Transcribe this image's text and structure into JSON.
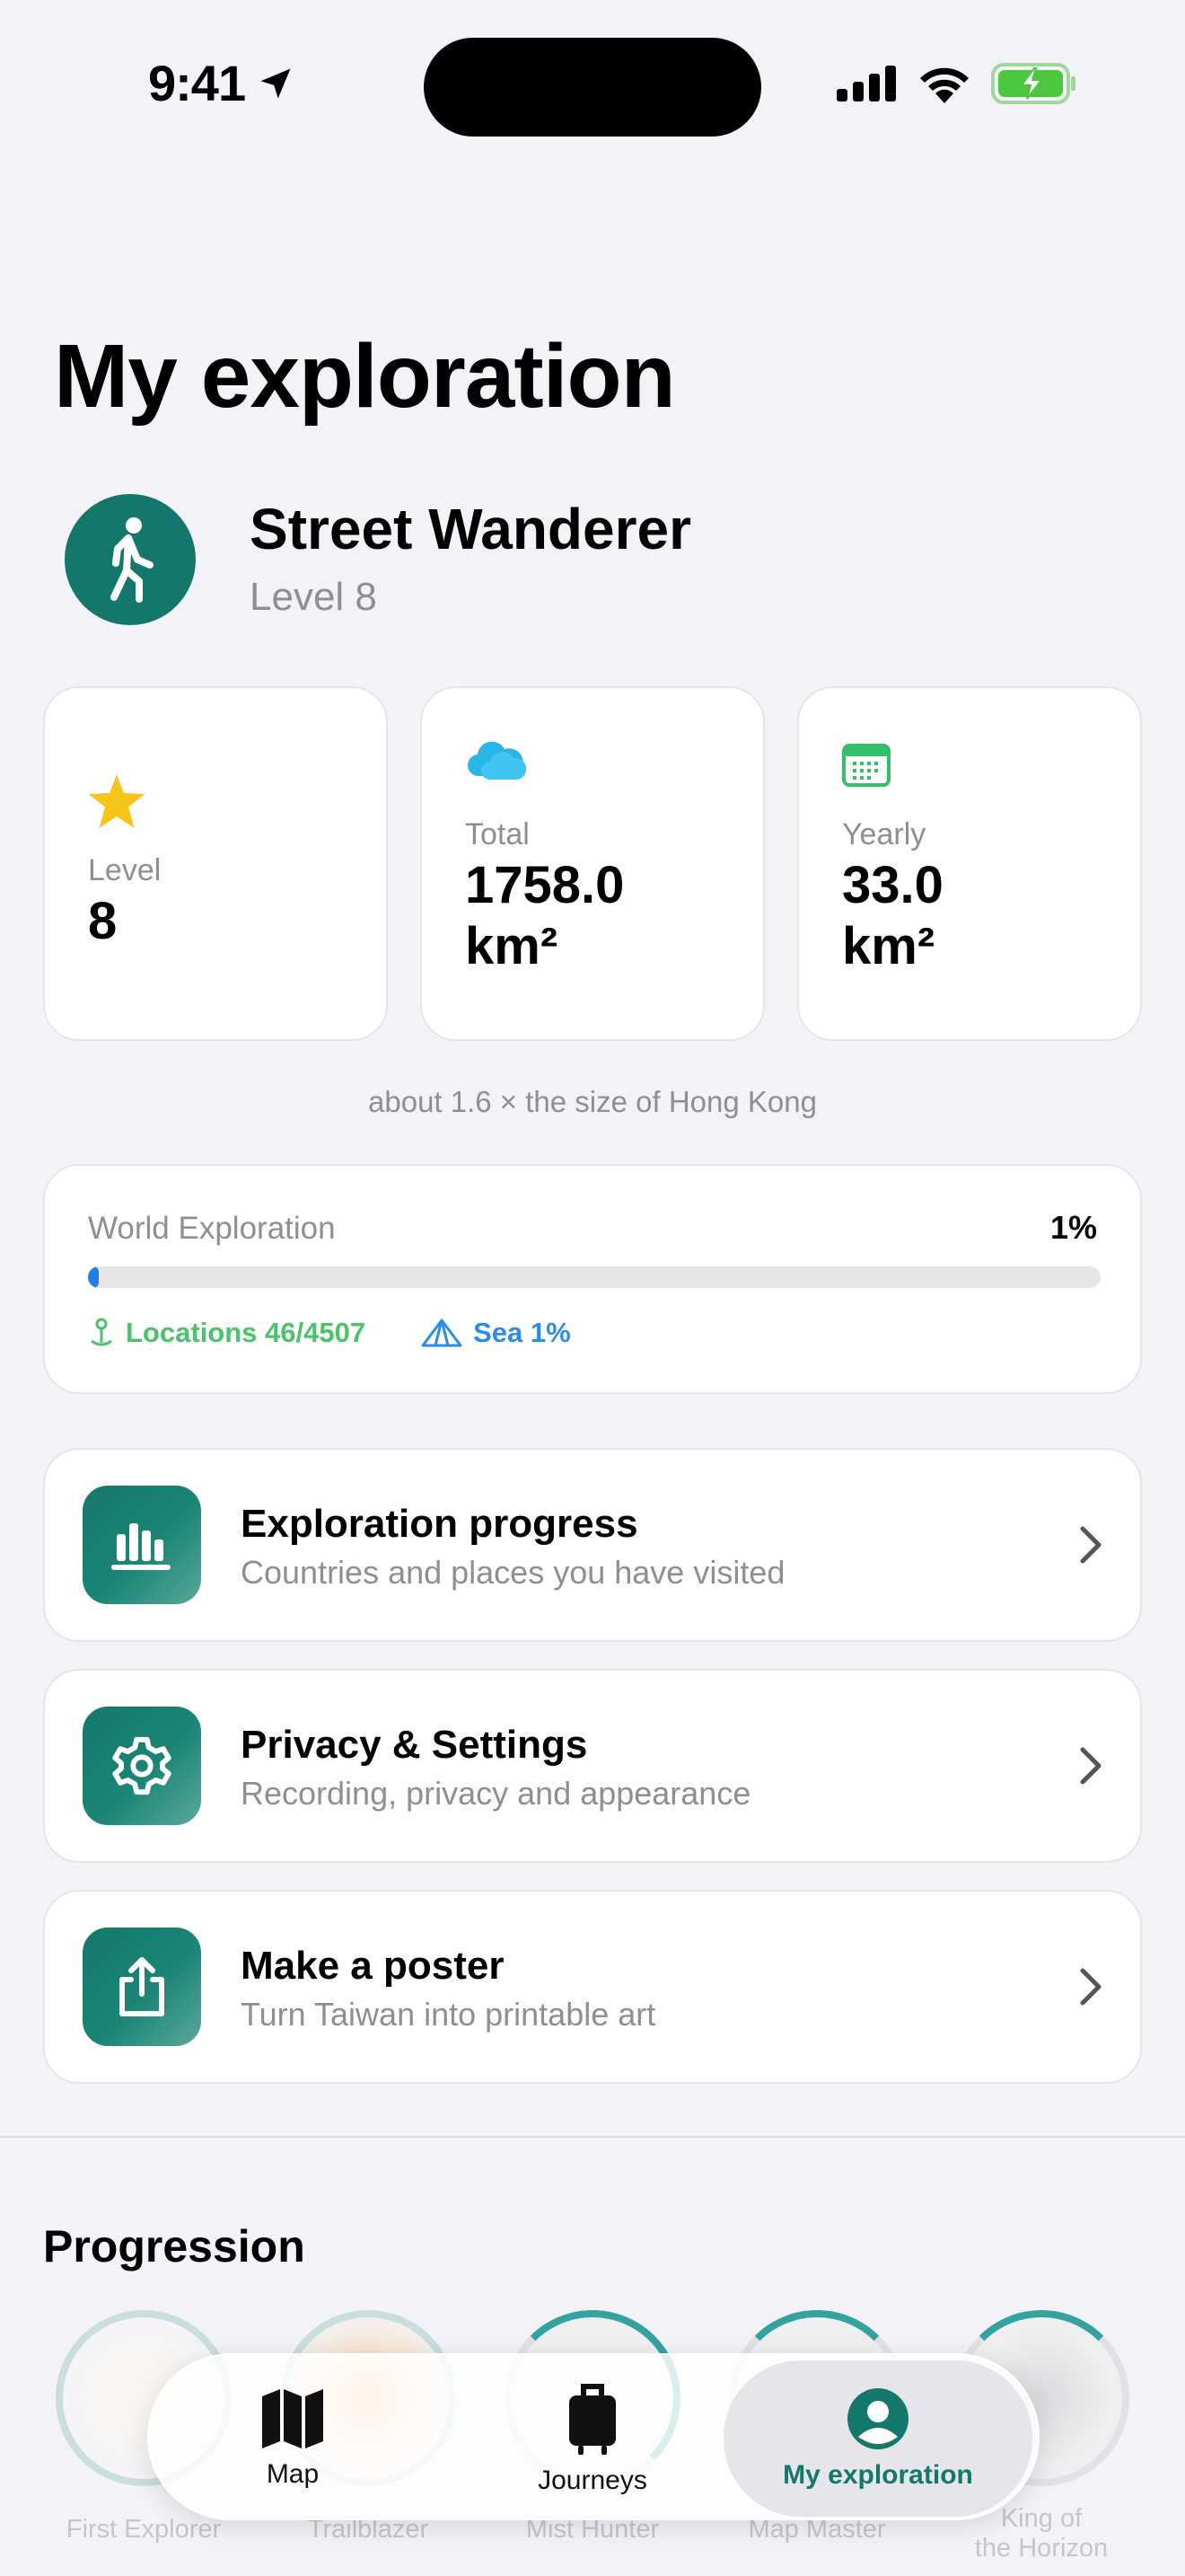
{
  "status": {
    "time": "9:41"
  },
  "page_title": "My exploration",
  "profile": {
    "name": "Street Wanderer",
    "level": "Level 8"
  },
  "stats": [
    {
      "label": "Level",
      "value": "8",
      "icon": "star-icon",
      "color": "#f5c518"
    },
    {
      "label": "Total",
      "value_line1": "1758.0",
      "value_line2": "km²",
      "icon": "cloud-icon",
      "color": "#27b6e6"
    },
    {
      "label": "Yearly",
      "value_line1": "33.0",
      "value_line2": "km²",
      "icon": "calendar-icon",
      "color": "#34c06a"
    }
  ],
  "comparison": "about 1.6 × the size of Hong Kong",
  "world": {
    "title": "World Exploration",
    "percent": "1%",
    "progress_fraction": 0.01,
    "locations": "Locations 46/4507",
    "sea": "Sea 1%"
  },
  "menu": [
    {
      "title": "Exploration progress",
      "subtitle": "Countries and places you have visited",
      "icon": "bar-chart-icon"
    },
    {
      "title": "Privacy & Settings",
      "subtitle": "Recording, privacy and appearance",
      "icon": "gear-icon"
    },
    {
      "title": "Make a poster",
      "subtitle": "Turn Taiwan into printable art",
      "icon": "share-icon"
    }
  ],
  "progression": {
    "title": "Progression",
    "badges": [
      {
        "label": "First Explorer"
      },
      {
        "label": "Trailblazer"
      },
      {
        "label": "Mist Hunter"
      },
      {
        "label": "Map Master"
      },
      {
        "label_line1": "King of",
        "label_line2": "the Horizon"
      }
    ]
  },
  "tabs": [
    {
      "label": "Map",
      "icon": "map-icon"
    },
    {
      "label": "Journeys",
      "icon": "suitcase-icon"
    },
    {
      "label": "My exploration",
      "icon": "person-icon"
    }
  ],
  "colors": {
    "accent": "#13786b",
    "background": "#f2f2f7"
  }
}
